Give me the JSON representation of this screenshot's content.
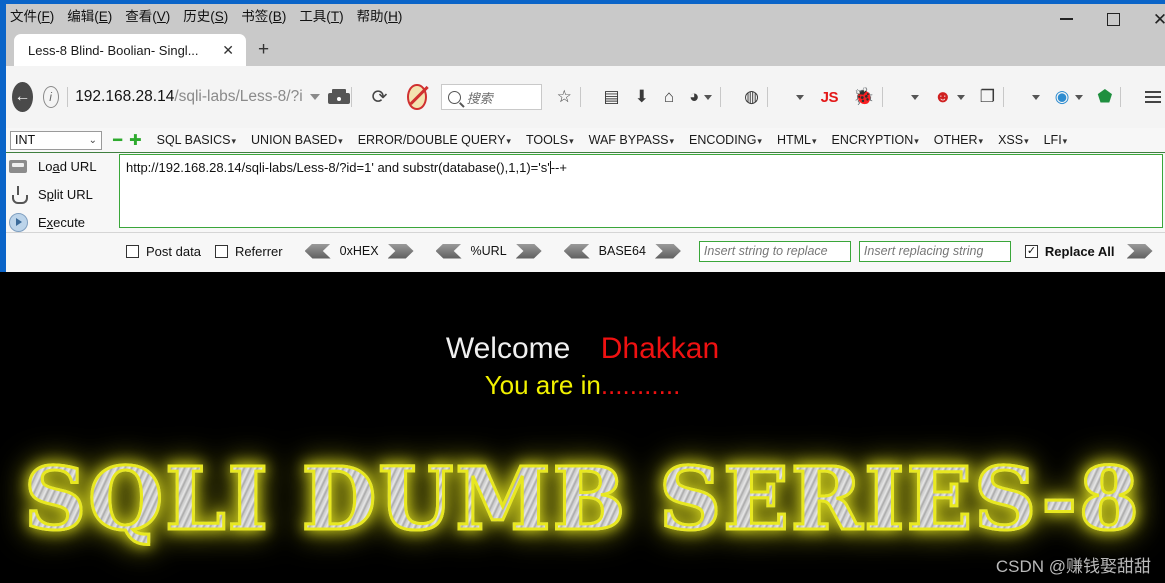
{
  "window": {
    "menu": [
      {
        "pre": "文件(",
        "key": "F",
        "post": ")"
      },
      {
        "pre": "编辑(",
        "key": "E",
        "post": ")"
      },
      {
        "pre": "查看(",
        "key": "V",
        "post": ")"
      },
      {
        "pre": "历史(",
        "key": "S",
        "post": ")"
      },
      {
        "pre": "书签(",
        "key": "B",
        "post": ")"
      },
      {
        "pre": "工具(",
        "key": "T",
        "post": ")"
      },
      {
        "pre": "帮助(",
        "key": "H",
        "post": ")"
      }
    ],
    "controls": {
      "minimize": "–",
      "maximize": "□",
      "close": "✕"
    }
  },
  "tabs": {
    "active_title": "Less-8 Blind- Boolian- Singl...",
    "close_label": "✕",
    "new_tab_label": "+"
  },
  "navbar": {
    "back_label": "←",
    "info_label": "i",
    "url_host": "192.168.28.14",
    "url_path": "/sqli-labs/Less-8/?i",
    "reload_label": "⟳",
    "search_placeholder": "搜索",
    "js_label": "JS"
  },
  "hackbar": {
    "type_select": {
      "value": "INT",
      "caret": "⌄"
    },
    "remove_label": "━",
    "add_label": "✚",
    "menus": [
      {
        "label": "SQL BASICS",
        "arrow": "▾"
      },
      {
        "label": "UNION BASED",
        "arrow": "▾"
      },
      {
        "label": "ERROR/DOUBLE QUERY",
        "arrow": "▾"
      },
      {
        "label": "TOOLS",
        "arrow": "▾"
      },
      {
        "label": "WAF BYPASS",
        "arrow": "▾"
      },
      {
        "label": "ENCODING",
        "arrow": "▾"
      },
      {
        "label": "HTML",
        "arrow": "▾"
      },
      {
        "label": "ENCRYPTION",
        "arrow": "▾"
      },
      {
        "label": "OTHER",
        "arrow": "▾"
      },
      {
        "label": "XSS",
        "arrow": "▾"
      },
      {
        "label": "LFI",
        "arrow": "▾"
      }
    ],
    "actions": [
      {
        "pre": "Lo",
        "key": "a",
        "post": "d URL"
      },
      {
        "pre": "S",
        "key": "p",
        "post": "lit URL"
      },
      {
        "pre": "E",
        "key": "x",
        "post": "ecute"
      }
    ],
    "url_value": "http://192.168.28.14/sqli-labs/Less-8/?id=1' and substr(database(),1,1)='s'",
    "url_value_tail": "--+",
    "options": {
      "post_data": {
        "label": "Post data",
        "checked": false,
        "mark": ""
      },
      "referrer": {
        "label": "Referrer",
        "checked": false,
        "mark": ""
      },
      "encoders": [
        "0xHEX",
        "%URL",
        "BASE64"
      ],
      "replace_search_placeholder": "Insert string to replace",
      "replace_with_placeholder": "Insert replacing string",
      "replace_all": {
        "label": "Replace All",
        "checked": true,
        "mark": "✓"
      }
    }
  },
  "page": {
    "welcome_text": "Welcome",
    "welcome_name": "Dhakkan",
    "status_text": "You are in",
    "status_dots": "...........",
    "logo_text": "SQLI DUMB SERIES-8",
    "watermark": "CSDN @赚钱娶甜甜"
  },
  "colors": {
    "accent_green": "#3aa63a",
    "welcome_name": "#ef1111",
    "status": "#f2f200",
    "logo_glow": "#e8e820",
    "titlebar_blue": "#0a64c8"
  }
}
